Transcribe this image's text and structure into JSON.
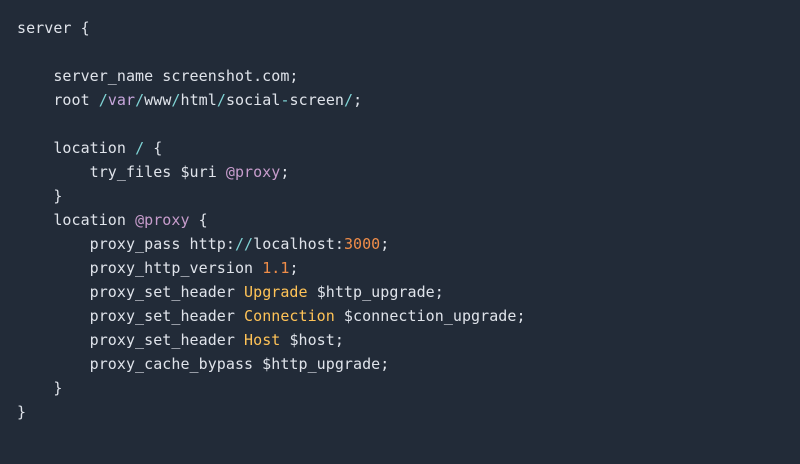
{
  "colors": {
    "background": "#222b38",
    "text": "#dfe3ea",
    "punctuation": "#7fd3d4",
    "path": "#c7a6dc",
    "variable": "#c79ccc",
    "number": "#f08d49",
    "keyword": "#ffc357"
  },
  "code": {
    "lines": [
      [
        {
          "t": "server {",
          "c": "plain"
        }
      ],
      [],
      [
        {
          "t": "    server_name screenshot.com;",
          "c": "plain"
        }
      ],
      [
        {
          "t": "    root ",
          "c": "plain"
        },
        {
          "t": "/",
          "c": "punct"
        },
        {
          "t": "var",
          "c": "path"
        },
        {
          "t": "/",
          "c": "punct"
        },
        {
          "t": "www",
          "c": "plain"
        },
        {
          "t": "/",
          "c": "punct"
        },
        {
          "t": "html",
          "c": "plain"
        },
        {
          "t": "/",
          "c": "punct"
        },
        {
          "t": "social",
          "c": "plain"
        },
        {
          "t": "-",
          "c": "punct"
        },
        {
          "t": "screen",
          "c": "plain"
        },
        {
          "t": "/",
          "c": "punct"
        },
        {
          "t": ";",
          "c": "plain"
        }
      ],
      [],
      [
        {
          "t": "    location ",
          "c": "plain"
        },
        {
          "t": "/",
          "c": "punct"
        },
        {
          "t": " {",
          "c": "plain"
        }
      ],
      [
        {
          "t": "        try_files $uri ",
          "c": "plain"
        },
        {
          "t": "@proxy",
          "c": "var"
        },
        {
          "t": ";",
          "c": "plain"
        }
      ],
      [
        {
          "t": "    }",
          "c": "plain"
        }
      ],
      [
        {
          "t": "    location ",
          "c": "plain"
        },
        {
          "t": "@proxy",
          "c": "var"
        },
        {
          "t": " {",
          "c": "plain"
        }
      ],
      [
        {
          "t": "        proxy_pass http:",
          "c": "plain"
        },
        {
          "t": "//",
          "c": "punct"
        },
        {
          "t": "localhost:",
          "c": "plain"
        },
        {
          "t": "3000",
          "c": "num"
        },
        {
          "t": ";",
          "c": "plain"
        }
      ],
      [
        {
          "t": "        proxy_http_version ",
          "c": "plain"
        },
        {
          "t": "1.1",
          "c": "num"
        },
        {
          "t": ";",
          "c": "plain"
        }
      ],
      [
        {
          "t": "        proxy_set_header ",
          "c": "plain"
        },
        {
          "t": "Upgrade",
          "c": "kw"
        },
        {
          "t": " $http_upgrade;",
          "c": "plain"
        }
      ],
      [
        {
          "t": "        proxy_set_header ",
          "c": "plain"
        },
        {
          "t": "Connection",
          "c": "kw"
        },
        {
          "t": " $connection_upgrade;",
          "c": "plain"
        }
      ],
      [
        {
          "t": "        proxy_set_header ",
          "c": "plain"
        },
        {
          "t": "Host",
          "c": "kw"
        },
        {
          "t": " $host;",
          "c": "plain"
        }
      ],
      [
        {
          "t": "        proxy_cache_bypass $http_upgrade;",
          "c": "plain"
        }
      ],
      [
        {
          "t": "    }",
          "c": "plain"
        }
      ],
      [
        {
          "t": "}",
          "c": "plain"
        }
      ]
    ]
  }
}
